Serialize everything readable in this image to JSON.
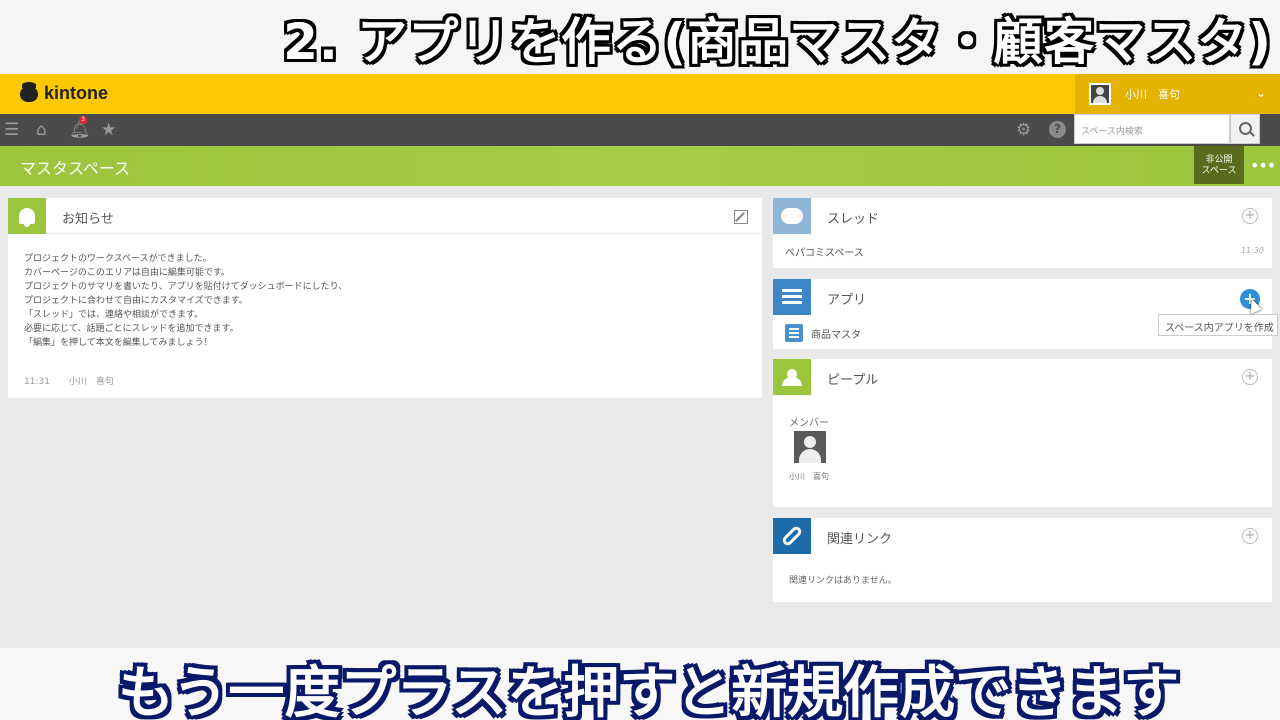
{
  "captions": {
    "top": "2. アプリを作る(商品マスタ・顧客マスタ)",
    "bottom": "もう一度プラスを押すと新規作成できます"
  },
  "header": {
    "logo": "kintone",
    "user_name": "小川　喜句",
    "badge_count": "3"
  },
  "nav": {
    "search_placeholder": "スペース内検索"
  },
  "space": {
    "title": "マスタスペース",
    "private_tag_line1": "非公開",
    "private_tag_line2": "スペース"
  },
  "notice": {
    "title": "お知らせ",
    "body": [
      "プロジェクトのワークスペースができました。",
      "カバーページのこのエリアは自由に編集可能です。",
      "プロジェクトのサマリを書いたり、アプリを貼付けてダッシュボードにしたり、",
      "プロジェクトに合わせて自由にカスタマイズできます。",
      "「スレッド」では、連絡や相談ができます。",
      "必要に応じて、話題ごとにスレッドを追加できます。",
      "「編集」を押して本文を編集してみましょう！"
    ],
    "time": "11:31",
    "author": "小川　喜句"
  },
  "thread": {
    "title": "スレッド",
    "item": "ペパコミスペース",
    "item_time": "11:30"
  },
  "apps": {
    "title": "アプリ",
    "item": "商品マスタ",
    "tooltip": "スペース内アプリを作成"
  },
  "people": {
    "title": "ピープル",
    "members_label": "メンバー",
    "member_name": "小川　喜句"
  },
  "links": {
    "title": "関連リンク",
    "empty": "関連リンクはありません。"
  },
  "colors": {
    "header_yellow": "#fcc800",
    "space_green": "#9bc53d",
    "nav_dark": "#4b4b4b",
    "app_blue": "#2d8fd9"
  }
}
